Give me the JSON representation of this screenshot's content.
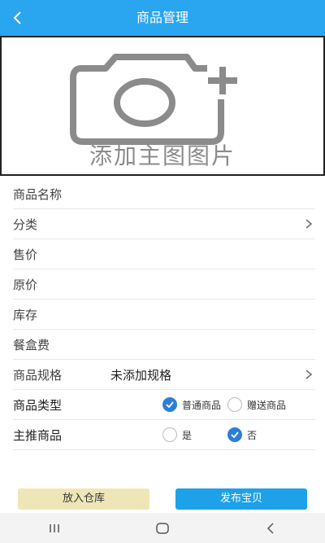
{
  "header": {
    "title": "商品管理",
    "back_icon": "chevron-left-icon"
  },
  "photo": {
    "caption": "添加主图图片",
    "icon": "camera-plus-icon"
  },
  "form": {
    "name_label": "商品名称",
    "category_label": "分类",
    "price_label": "售价",
    "original_price_label": "原价",
    "stock_label": "库存",
    "box_fee_label": "餐盒费",
    "spec_label": "商品规格",
    "spec_value": "未添加规格",
    "type_label": "商品类型",
    "type_options": [
      {
        "label": "普通商品",
        "selected": true
      },
      {
        "label": "赠送商品",
        "selected": false
      }
    ],
    "featured_label": "主推商品",
    "featured_options": [
      {
        "label": "是",
        "selected": false
      },
      {
        "label": "否",
        "selected": true
      }
    ]
  },
  "actions": {
    "store_label": "放入仓库",
    "publish_label": "发布宝贝"
  },
  "colors": {
    "header": "#2aa6f0",
    "radio_on": "#2d7ed8",
    "publish": "#1da1e9",
    "store": "#efe6b8"
  }
}
